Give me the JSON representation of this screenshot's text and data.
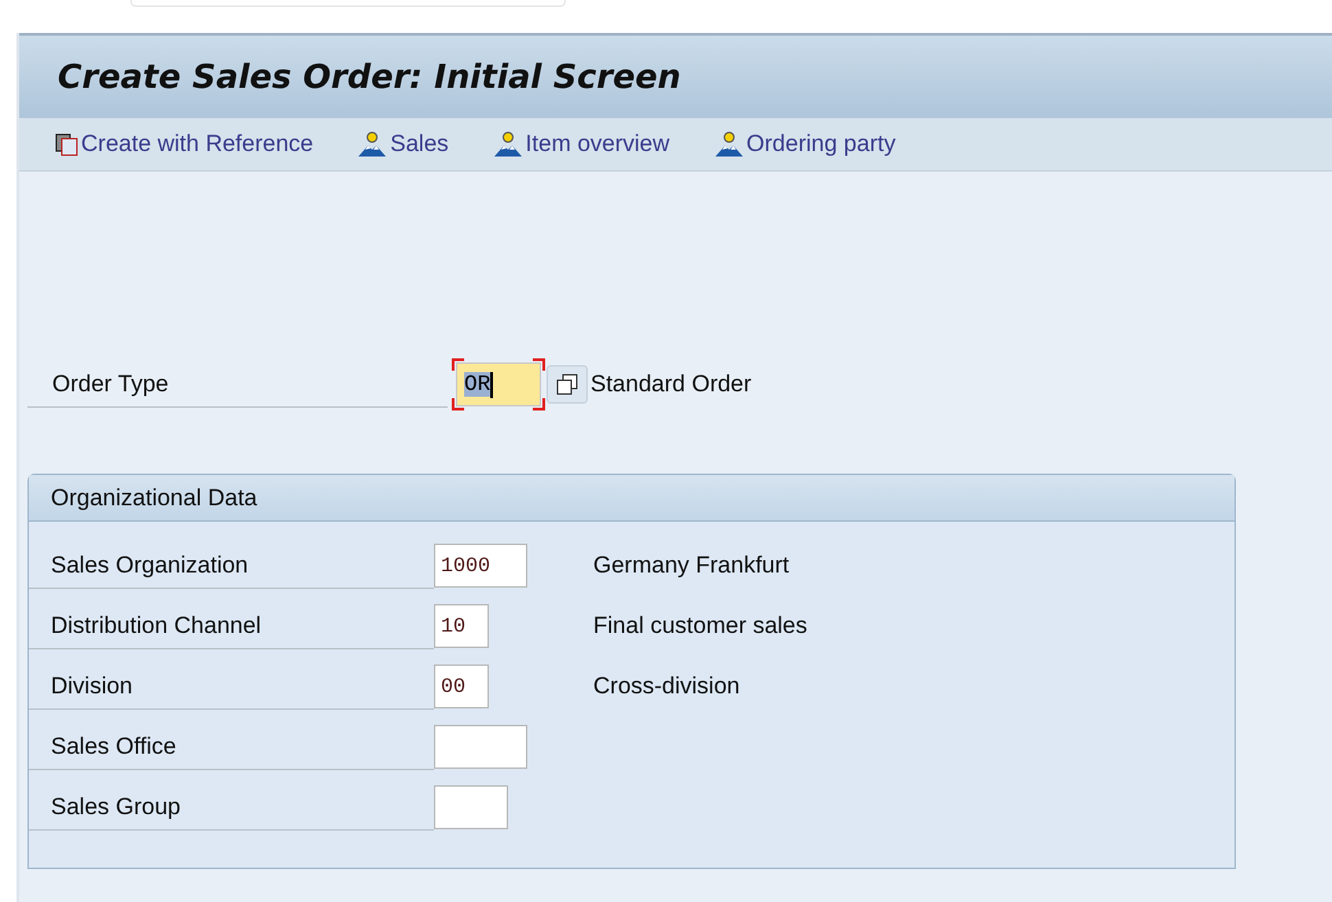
{
  "window": {
    "title": "Create Sales Order: Initial Screen"
  },
  "toolbar": [
    {
      "label": "Create with Reference",
      "kind": "copy"
    },
    {
      "label": "Sales",
      "kind": "overview"
    },
    {
      "label": "Item overview",
      "kind": "overview"
    },
    {
      "label": "Ordering party",
      "kind": "overview"
    }
  ],
  "order_type": {
    "label": "Order Type",
    "value": "OR",
    "focused": true,
    "description": "Standard Order"
  },
  "organizational_data": {
    "title": "Organizational Data",
    "fields": [
      {
        "label": "Sales Organization",
        "value": "1000",
        "description": "Germany Frankfurt"
      },
      {
        "label": "Distribution Channel",
        "value": "10",
        "description": "Final customer sales"
      },
      {
        "label": "Division",
        "value": "00",
        "description": "Cross-division"
      },
      {
        "label": "Sales Office"
      },
      {
        "label": "Sales Group"
      }
    ]
  }
}
